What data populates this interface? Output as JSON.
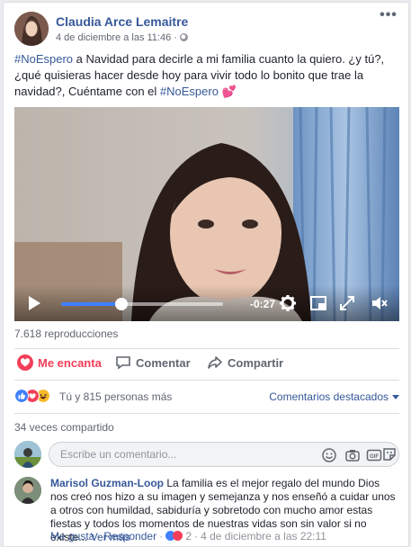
{
  "post": {
    "author": "Claudia Arce Lemaitre",
    "timestamp": "4 de diciembre a las 11:46",
    "visibility_icon": "globe-icon",
    "more_label": "•••",
    "text_tag1": "#NoEspero",
    "text_body": " a Navidad para decirle a mi familia cuanto la quiero. ¿y tú?, ¿qué quisieras hacer desde hoy para vivir todo lo bonito que trae la navidad?, Cuéntame con el ",
    "text_tag2": "#NoEspero",
    "text_emoji": "💕"
  },
  "video": {
    "time_remaining": "-0:27",
    "progress": 0.37,
    "icons": [
      "play-icon",
      "settings-icon",
      "picture-in-picture-icon",
      "fullscreen-icon",
      "mute-icon"
    ]
  },
  "stats": {
    "views": "7.618 reproducciones",
    "reactions_text": "Tú y 815 personas más",
    "top_comments": "Comentarios destacados",
    "shares": "34 veces compartido"
  },
  "actions": {
    "like": "Me encanta",
    "comment": "Comentar",
    "share": "Compartir"
  },
  "comment_input": {
    "placeholder": "Escribe un comentario..."
  },
  "comment": {
    "author": "Marisol Guzman-Loop",
    "text": " La familia es el mejor regalo del mundo Dios nos creó nos hizo a su imagen y semejanza y nos enseñó a cuidar unos a otros con humildad, sabiduría y sobretodo con mucho amor estas fiestas y todos los momentos de nuestras vidas son sin valor si no existe...",
    "see_more": "Ver más",
    "like_label": "Me gusta",
    "reply_label": "Responder",
    "reaction_count": "2",
    "date": "4 de diciembre a las 22:11"
  },
  "colors": {
    "link": "#365899",
    "love": "#f33e58",
    "like_blue": "#4080ff",
    "muted": "#616770"
  }
}
